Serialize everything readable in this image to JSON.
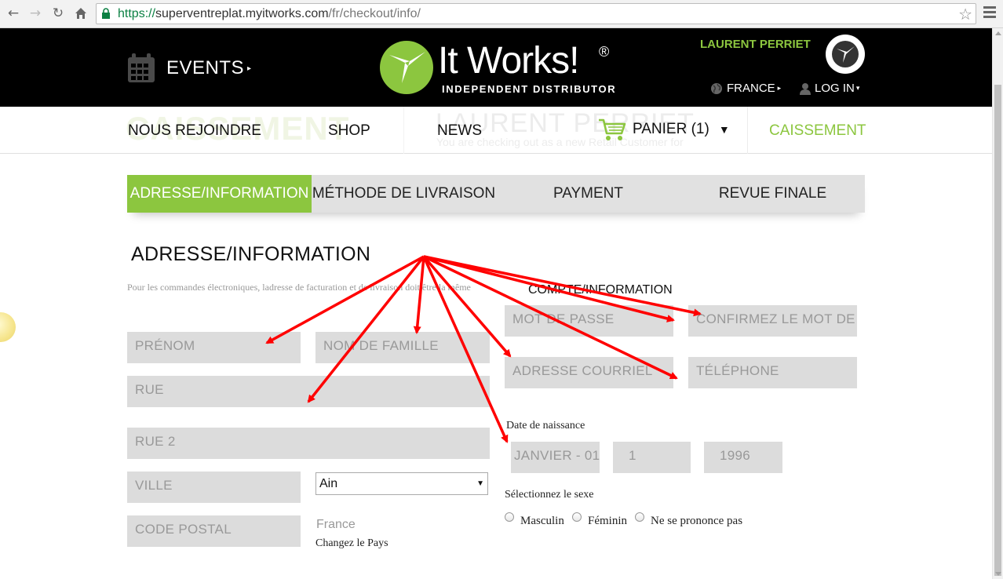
{
  "browser": {
    "url_scheme": "https://",
    "url_host": "superventreplat.myitworks.com",
    "url_path": "/fr/checkout/info/"
  },
  "header": {
    "events_label": "EVENTS",
    "logo_text": "It Works!",
    "logo_reg": "®",
    "logo_sub": "INDEPENDENT DISTRIBUTOR",
    "user_name": "LAURENT PERRIET",
    "country_label": "FRANCE",
    "login_label": "LOG IN"
  },
  "nav": {
    "ghost_title": "CAISSEMENT",
    "ghost_name": "LAURENT PERRIET",
    "ghost_sub": "You are checking out as a new Retail Customer for",
    "join": "NOUS REJOINDRE",
    "shop": "SHOP",
    "news": "NEWS",
    "cart": "PANIER (1)",
    "checkout": "CAISSEMENT"
  },
  "steps": [
    {
      "label": "ADRESSE/INFORMATION",
      "active": true
    },
    {
      "label": "MÉTHODE DE LIVRAISON",
      "active": false
    },
    {
      "label": "PAYMENT",
      "active": false
    },
    {
      "label": "REVUE FINALE",
      "active": false
    }
  ],
  "form": {
    "title": "ADRESSE/INFORMATION",
    "note": "Pour les commandes électroniques, ladresse de facturation et de livraison doit être la même",
    "first_name_placeholder": "PRÉNOM",
    "last_name_placeholder": "NOM DE FAMILLE",
    "street_placeholder": "RUE",
    "street2_placeholder": "RUE 2",
    "city_placeholder": "VILLE",
    "state_value": "Ain",
    "postal_placeholder": "CODE POSTAL",
    "country_value": "France",
    "change_country": "Changez le Pays"
  },
  "account": {
    "title": "COMPTE/INFORMATION",
    "password_placeholder": "MOT DE PASSE",
    "confirm_placeholder": "CONFIRMEZ LE MOT DE",
    "email_placeholder": "ADRESSE COURRIEL",
    "phone_placeholder": "TÉLÉPHONE",
    "dob_label": "Date de naissance",
    "dob_month": "JANVIER - 01",
    "dob_day": "1",
    "dob_year": "1996",
    "gender_label": "Sélectionnez le sexe",
    "gender_options": [
      "Masculin",
      "Féminin",
      "Ne se prononce pas"
    ]
  },
  "colors": {
    "brand_green": "#8cc63f",
    "header_bg": "#000000",
    "field_bg": "#dcdcdc",
    "annotation_red": "#ff0000"
  },
  "icons": {
    "back": "arrow-left-icon",
    "forward": "arrow-right-icon",
    "reload": "reload-icon",
    "home": "home-icon",
    "secure": "lock-icon",
    "bookmark": "star-icon",
    "menu": "hamburger-icon",
    "events": "calendar-icon",
    "globe": "globe-icon",
    "user": "user-icon",
    "cart": "cart-icon"
  }
}
